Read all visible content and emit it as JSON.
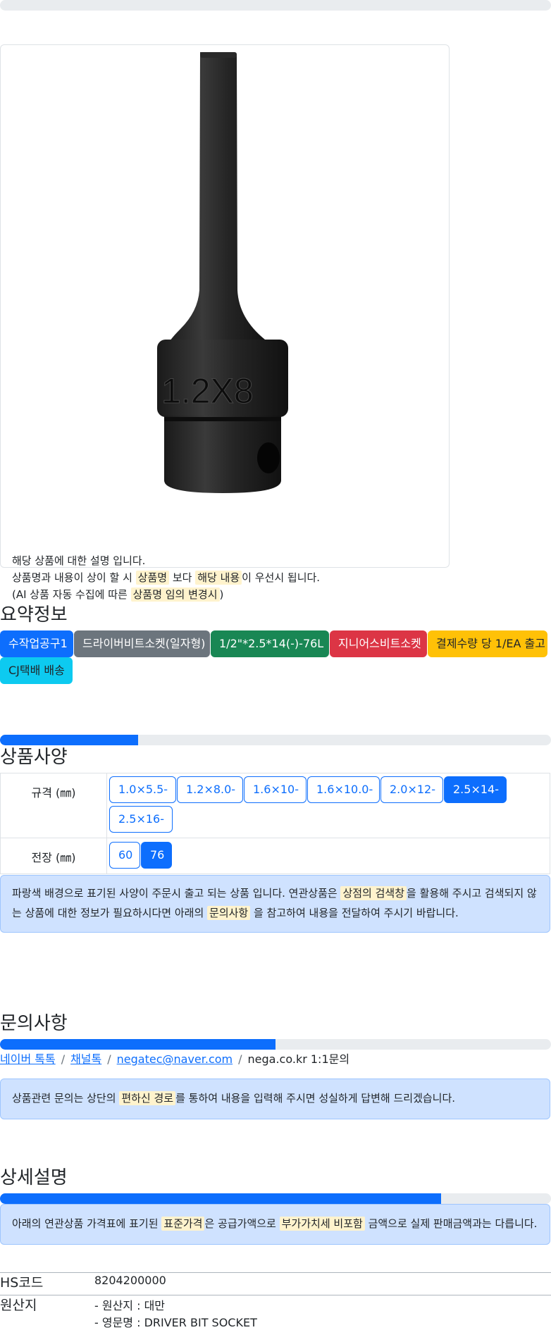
{
  "top_progress": {
    "percent": 0
  },
  "product_card": {
    "image_alt": "드라이버비트소켓 1.2X8",
    "image_text": "1.2X8",
    "line1": "해당 상품에 대한 설명 입니다.",
    "line2": {
      "a": "상품명과 내용이 상이 할 시 ",
      "m1": "상품명",
      "b": " 보다 ",
      "m2": "해당 내용",
      "c": "이 우선시 됩니다."
    },
    "line3": {
      "a": "(AI 상품 자동 수집에 따른 ",
      "m1": "상품명 임의 변경시",
      "b": ")"
    }
  },
  "summary": {
    "title": "요약정보",
    "badges": [
      {
        "label": "수작업공구1",
        "color": "#0d6efd"
      },
      {
        "label": "드라이버비트소켓(일자형)",
        "color": "#6c757d"
      },
      {
        "label": "1/2\"*2.5*14(-)-76L",
        "color": "#198754"
      },
      {
        "label": "지니어스비트소켓",
        "color": "#dc3545"
      },
      {
        "label": "결제수량 당 1/EA 출고",
        "color": "#ffc107"
      },
      {
        "label": "CJ택배 배송",
        "color": "#0dcaf0"
      }
    ]
  },
  "specs": {
    "progress_percent": 25,
    "title": "상품사양",
    "rows": [
      {
        "label": "규격 (㎜)",
        "options": [
          "1.0×5.5-",
          "1.2×8.0-",
          "1.6×10-",
          "1.6×10.0-",
          "2.0×12-",
          "2.5×14-",
          "2.5×16-"
        ],
        "selected": "2.5×14-"
      },
      {
        "label": "전장 (㎜)",
        "options": [
          "60",
          "76"
        ],
        "selected": "76"
      }
    ],
    "notice": {
      "a": "파랑색 배경으로 표기된 사양이 주문시 출고 되는 상품 입니다. 연관상품은 ",
      "m1": "상점의 검색창",
      "b": "을 활용해 주시고 검색되지 않",
      "c": "는 상품에 대한 정보가 필요하시다면 아래의 ",
      "m2": "문의사항",
      "d": " 을 참고하여 내용을 전달하여 주시기 바랍니다."
    }
  },
  "inquiry": {
    "title": "문의사항",
    "progress_percent": 50,
    "links": [
      "네이버 톡톡",
      "채널톡",
      "negatec@naver.com"
    ],
    "plain": "nega.co.kr 1:1문의",
    "separator": "/",
    "notice": {
      "a": "상품관련 문의는 상단의 ",
      "m1": "편하신 경로",
      "b": "를 통하여 내용을 입력해 주시면 성실하게 답변해 드리겠습니다."
    }
  },
  "detail": {
    "title": "상세설명",
    "progress_percent": 80,
    "notice": {
      "a": "아래의 연관상품 가격표에 표기된 ",
      "m1": "표준가격",
      "b": "은 공급가액으로 ",
      "m2": "부가가치세 비포함",
      "c": " 금액으로 실제 판매금액과는 다릅니다."
    },
    "info": [
      {
        "key": "HS코드",
        "lines": [
          "8204200000"
        ]
      },
      {
        "key": "원산지",
        "lines": [
          "- 원산지 : 대만",
          "- 영문명 : DRIVER BIT SOCKET"
        ]
      }
    ]
  }
}
